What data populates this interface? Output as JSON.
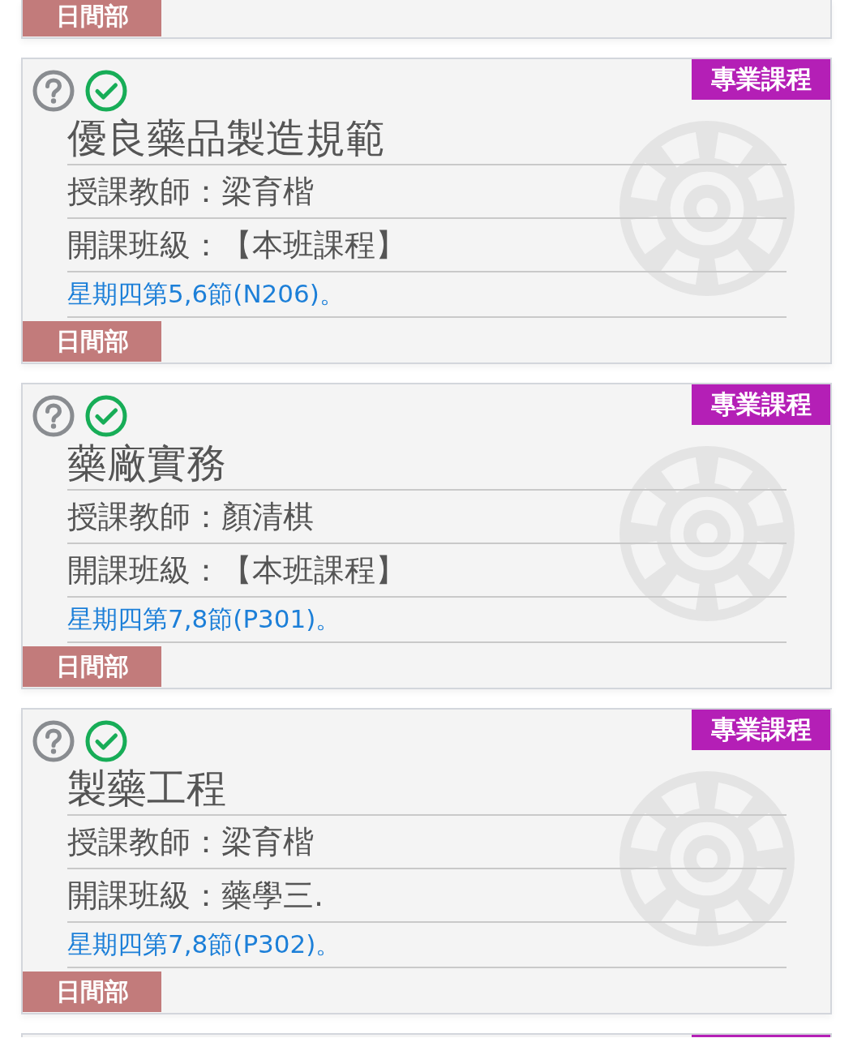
{
  "cards": [
    {
      "kind": "footer_only",
      "division": "日間部"
    },
    {
      "kind": "full",
      "category": "專業課程",
      "title": "優良藥品製造規範",
      "teacher": "授課教師：梁育楷",
      "class": "開課班級：【本班課程】",
      "schedule": "星期四第5,6節(N206)。",
      "division": "日間部"
    },
    {
      "kind": "full",
      "category": "專業課程",
      "title": "藥廠實務",
      "teacher": "授課教師：顏清棋",
      "class": "開課班級：【本班課程】",
      "schedule": "星期四第7,8節(P301)。",
      "division": "日間部"
    },
    {
      "kind": "full",
      "category": "專業課程",
      "title": "製藥工程",
      "teacher": "授課教師：梁育楷",
      "class": "開課班級：藥學三.",
      "schedule": "星期四第7,8節(P302)。",
      "division": "日間部"
    },
    {
      "kind": "header_only"
    }
  ]
}
